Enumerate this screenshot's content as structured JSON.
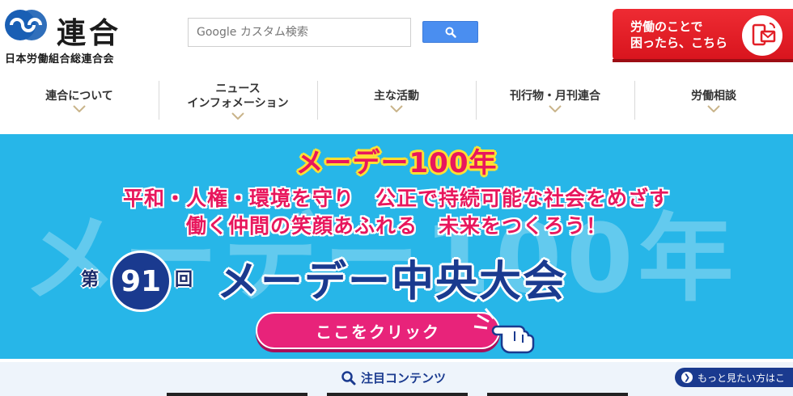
{
  "header": {
    "logo_name": "連合",
    "logo_sub": "日本労働組合総連合会",
    "search_placeholder": "Google カスタム検索",
    "consult_line1": "労働のことで",
    "consult_line2": "困ったら、こちら"
  },
  "nav": {
    "items": [
      {
        "label": "連合について"
      },
      {
        "label": "ニュース\nインフォメーション"
      },
      {
        "label": "主な活動"
      },
      {
        "label": "刊行物・月刊連合"
      },
      {
        "label": "労働相談"
      }
    ]
  },
  "banner": {
    "bg_text": "メーデー100年",
    "title": "メーデー100年",
    "line1": "平和・人権・環境を守り　公正で持続可能な社会をめざす",
    "line2": "働く仲間の笑顔あふれる　未来をつくろう！",
    "dai": "第",
    "number": "91",
    "kai": "回",
    "main": "メーデー中央大会",
    "click_label": "ここをクリック"
  },
  "featured": {
    "title": "注目コンテンツ",
    "more_label": "もっと見たい方はこ"
  },
  "colors": {
    "brand_blue": "#1a3a8f",
    "banner_bg": "#27b6e8",
    "consult_red": "#e21f27",
    "accent_pink": "#e8175d",
    "search_btn": "#4a8ef0"
  }
}
